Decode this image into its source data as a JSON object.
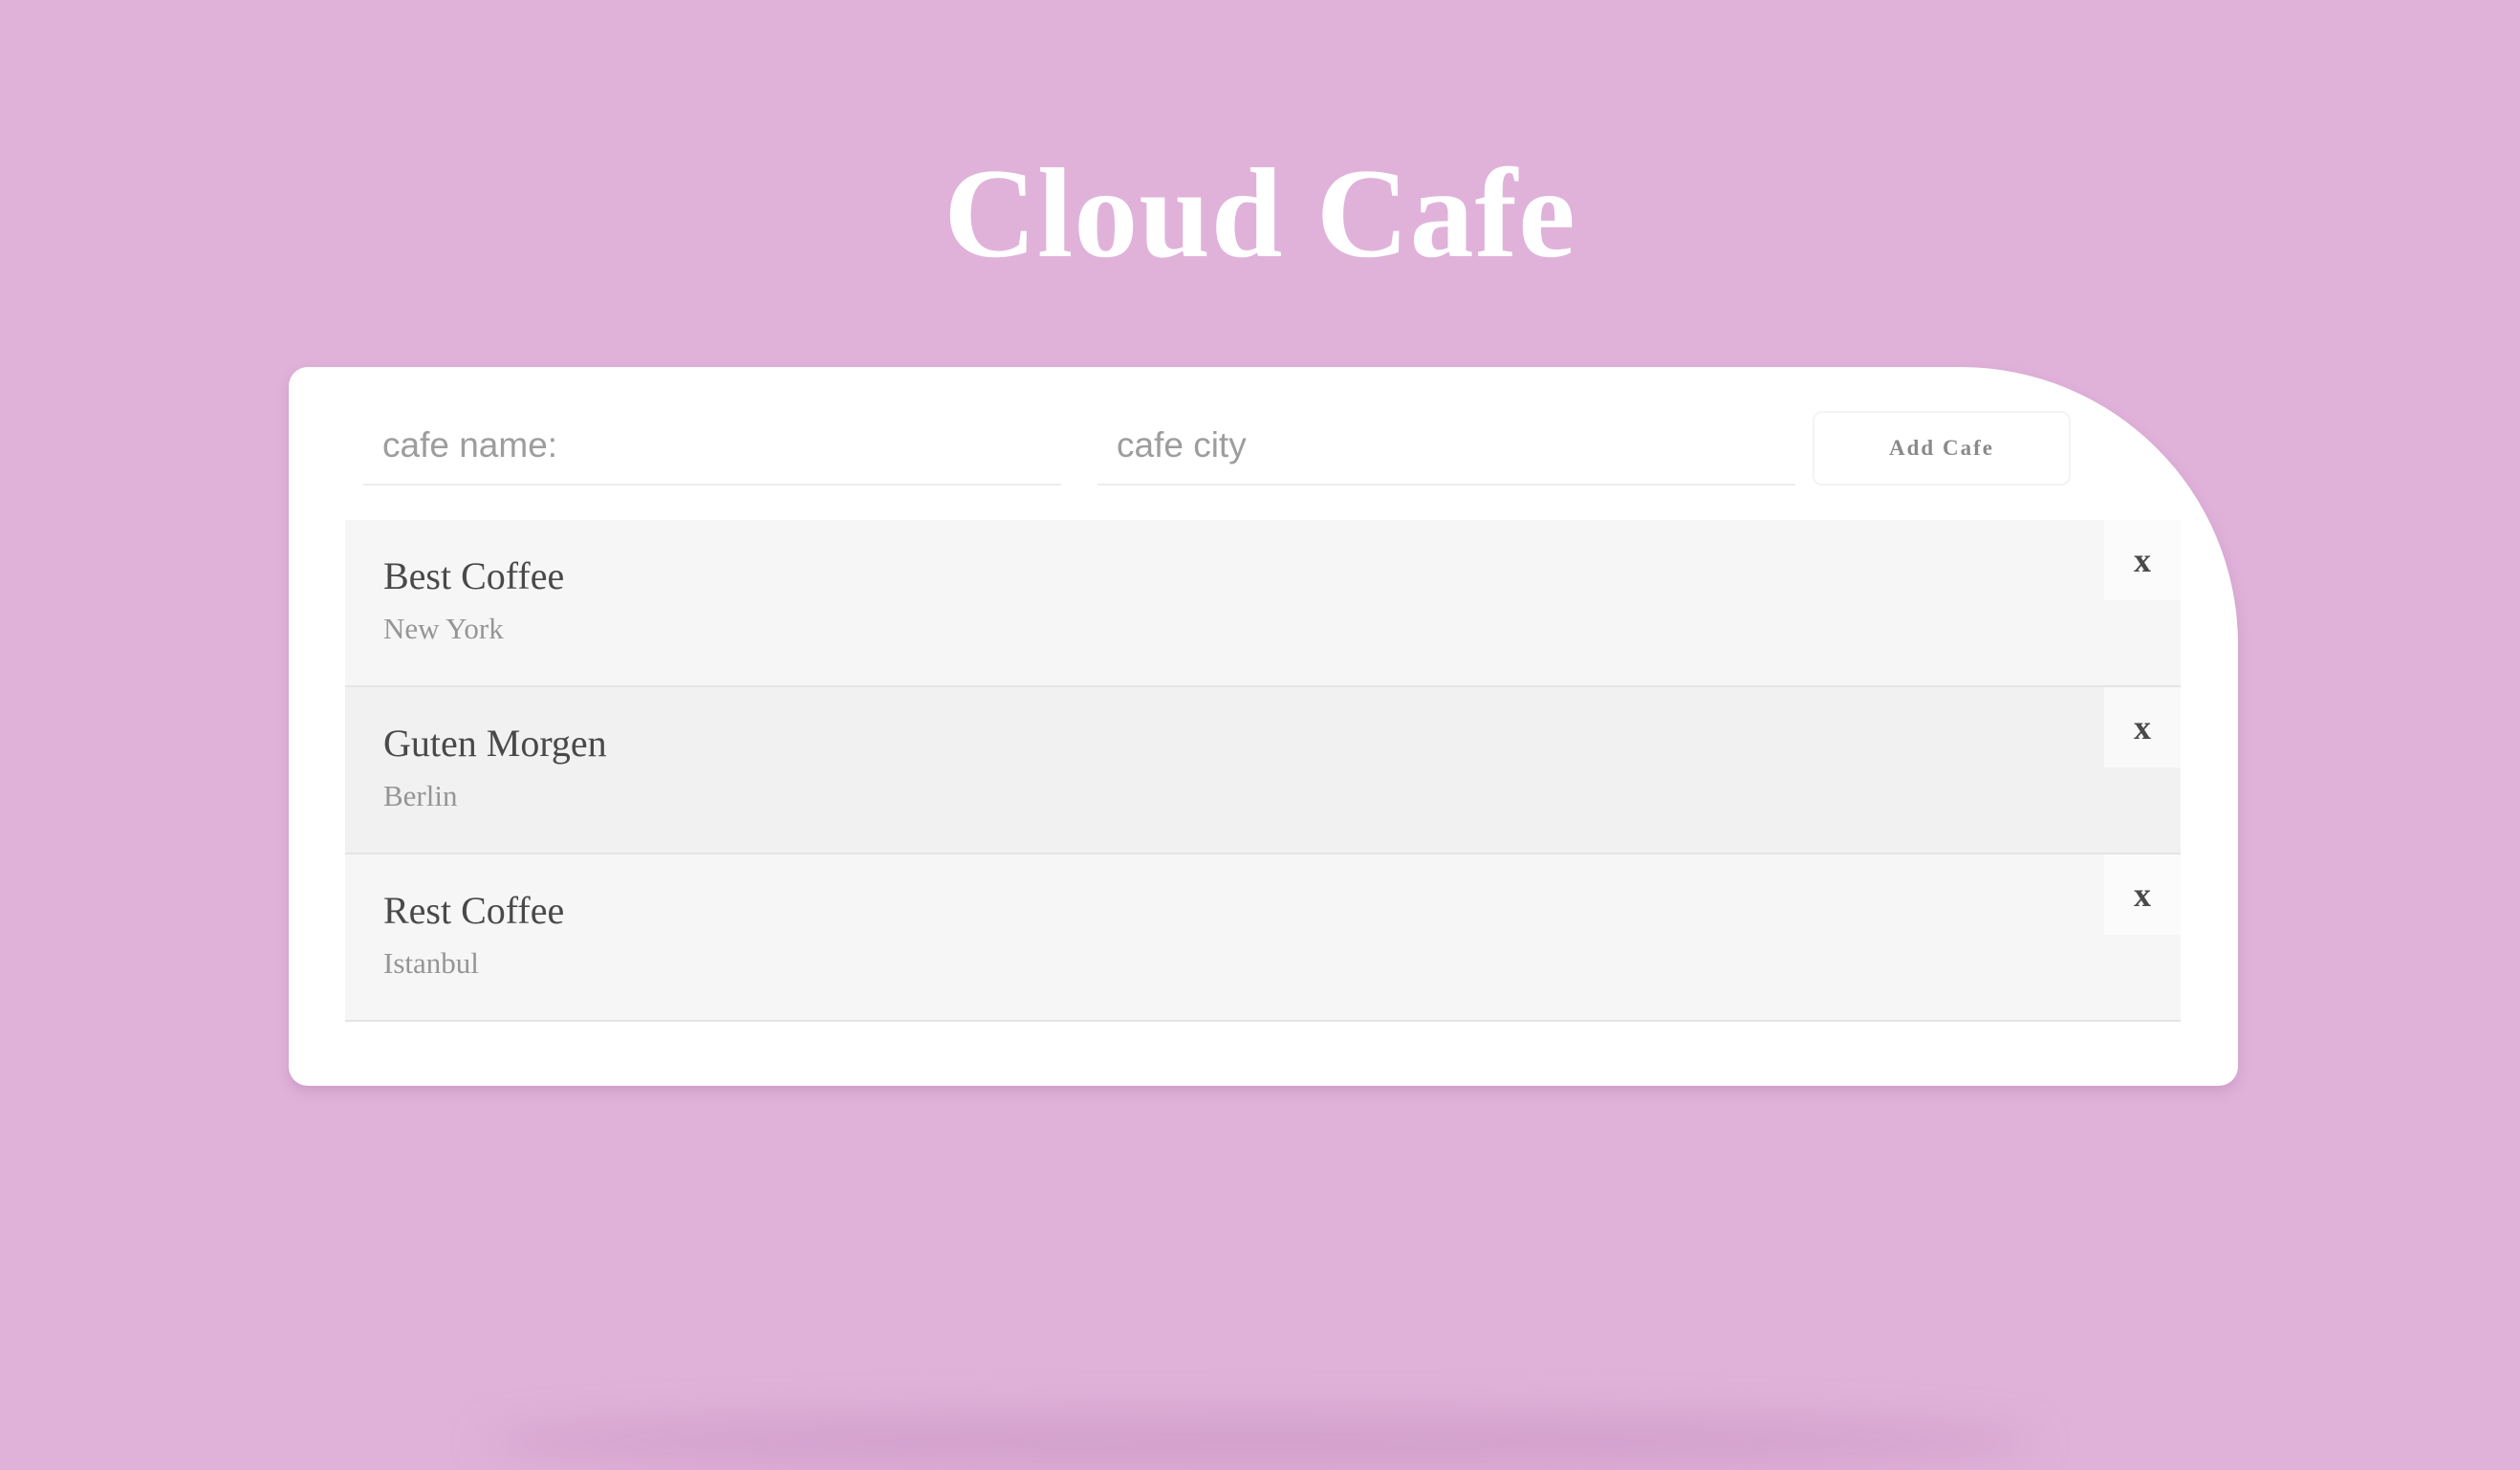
{
  "page": {
    "title": "Cloud Cafe"
  },
  "form": {
    "name_placeholder": "cafe name:",
    "city_placeholder": "cafe city",
    "name_value": "",
    "city_value": "",
    "add_label": "Add Cafe"
  },
  "cafes": [
    {
      "name": "Best Coffee",
      "city": "New York",
      "delete_label": "x"
    },
    {
      "name": "Guten Morgen",
      "city": "Berlin",
      "delete_label": "x"
    },
    {
      "name": "Rest Coffee",
      "city": "Istanbul",
      "delete_label": "x"
    }
  ],
  "colors": {
    "background": "#e0b2da",
    "card": "#ffffff",
    "title": "#ffffff"
  }
}
